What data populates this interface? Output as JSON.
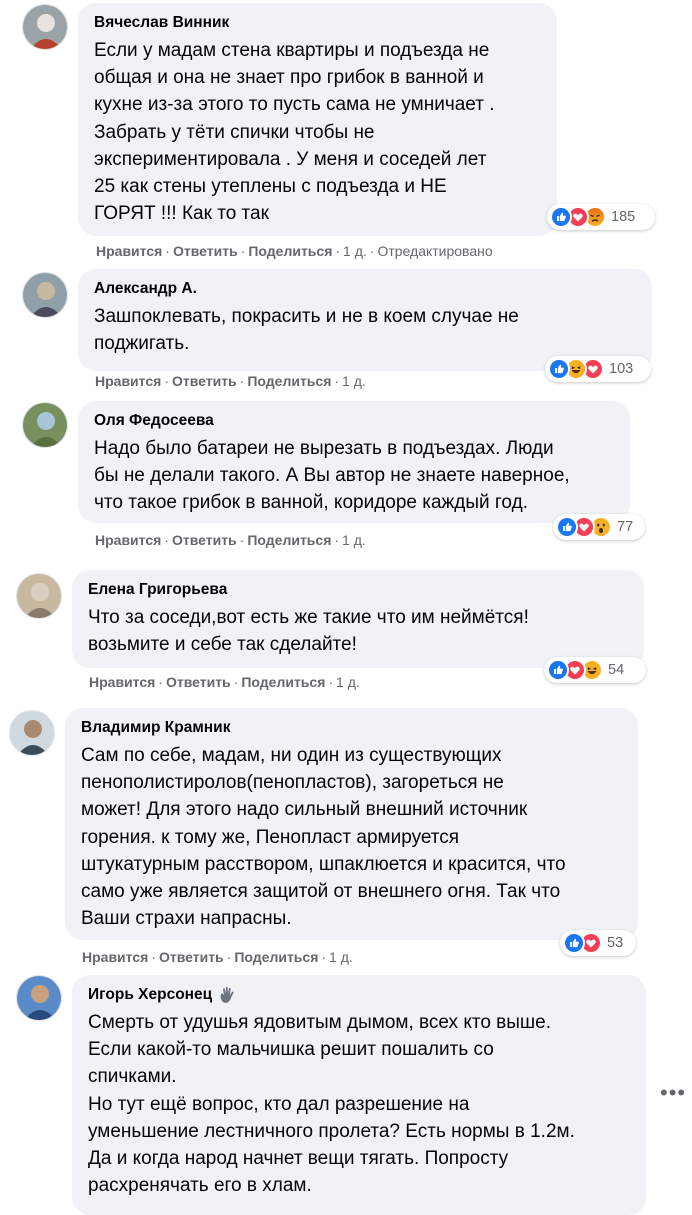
{
  "comments": [
    {
      "author": "Вячеслав Винник",
      "lines": [
        "Если у мадам стена квартиры и подъезда не",
        "общая и она не знает про грибок в ванной и",
        "кухне из-за этого то пусть сама не умничает .",
        "Забрать у тёти спички чтобы не",
        "экспериментировала . У меня и соседей лет",
        "25 как стены утеплены с подъезда и НЕ",
        "ГОРЯТ !!! Как то так"
      ],
      "reactions": [
        "like-icon",
        "love-icon",
        "angry-icon"
      ],
      "reaction_count": "185",
      "actions": {
        "like": "Нравится",
        "reply": "Ответить",
        "share": "Поделиться",
        "time": "1 д.",
        "edited": "Отредактировано"
      }
    },
    {
      "author": "Александр А.",
      "lines": [
        "Зашпоклевать, покрасить и не в коем случае не",
        "поджигать."
      ],
      "reactions": [
        "like-icon",
        "haha-icon",
        "love-icon"
      ],
      "reaction_count": "103",
      "actions": {
        "like": "Нравится",
        "reply": "Ответить",
        "share": "Поделиться",
        "time": "1 д."
      }
    },
    {
      "author": "Оля Федосеева",
      "lines": [
        "Надо было батареи не вырезать в подъездах. Люди",
        "бы не делали такого. А Вы автор не знаете наверное,",
        "что такое грибок в ванной, коридоре каждый год."
      ],
      "reactions": [
        "like-icon",
        "love-icon",
        "wow-icon"
      ],
      "reaction_count": "77",
      "actions": {
        "like": "Нравится",
        "reply": "Ответить",
        "share": "Поделиться",
        "time": "1 д."
      }
    },
    {
      "author": "Елена Григорьева",
      "lines": [
        "Что за соседи,вот есть же такие что им неймётся!",
        "возьмите и себе так сделайте!"
      ],
      "reactions": [
        "like-icon",
        "love-icon",
        "haha-icon"
      ],
      "reaction_count": "54",
      "actions": {
        "like": "Нравится",
        "reply": "Ответить",
        "share": "Поделиться",
        "time": "1 д."
      }
    },
    {
      "author": "Владимир Крамник",
      "lines": [
        "Сам по себе, мадам, ни один из существующих",
        "пенополистиролов(пенопластов), загореться не",
        "может! Для этого надо сильный внешний источник",
        "горения. к тому же, Пенопласт армируется",
        "штукатурным расствором, шпаклюется и красится, что",
        "само уже является защитой от внешнего огня. Так что",
        "Ваши страхи напрасны."
      ],
      "reactions": [
        "like-icon",
        "love-icon"
      ],
      "reaction_count": "53",
      "actions": {
        "like": "Нравится",
        "reply": "Ответить",
        "share": "Поделиться",
        "time": "1 д."
      }
    },
    {
      "author": "Игорь Херсонец",
      "author_badge": "waving-hand-icon",
      "lines": [
        "Смерть от удушья ядовитым дымом, всех кто выше.",
        "Если какой-то мальчишка решит пошалить со",
        "спичками.",
        "Но тут ещё вопрос, кто дал разрешение на",
        "уменьшение лестничного пролета? Есть нормы в 1.2м.",
        "Да и когда народ начнет вещи тягать. Попросту",
        "расхренячать его в хлам."
      ]
    }
  ],
  "more_options_icon": "more-horizontal-icon",
  "colors": {
    "bubble": "#f0f2f5",
    "like": "#1877f2",
    "love": "#f33e58",
    "emoji": "#f7b125",
    "angry": "#e9710f",
    "muted": "#65676b"
  }
}
